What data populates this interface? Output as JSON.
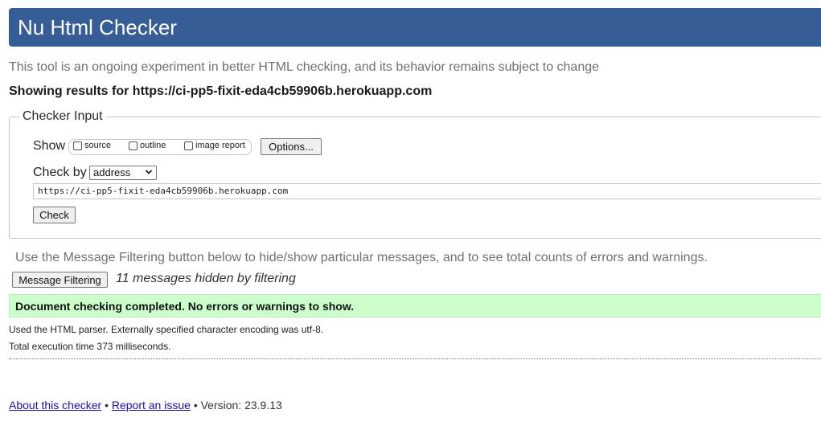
{
  "header": {
    "title": "Nu Html Checker"
  },
  "tagline": "This tool is an ongoing experiment in better HTML checking, and its behavior remains subject to change",
  "showing_results": "Showing results for https://ci-pp5-fixit-eda4cb59906b.herokuapp.com",
  "checker_input": {
    "legend": "Checker Input",
    "show_label": "Show",
    "show_options": [
      {
        "label": "source",
        "checked": false
      },
      {
        "label": "outline",
        "checked": false
      },
      {
        "label": "image report",
        "checked": false
      }
    ],
    "options_button": "Options...",
    "check_by_label": "Check by",
    "check_by_value": "address",
    "url_value": "https://ci-pp5-fixit-eda4cb59906b.herokuapp.com",
    "check_button": "Check"
  },
  "filtering": {
    "help_text": "Use the Message Filtering button below to hide/show particular messages, and to see total counts of errors and warnings.",
    "button_label": "Message Filtering",
    "hidden_count_text": "11 messages hidden by filtering"
  },
  "result": {
    "message": "Document checking completed. No errors or warnings to show.",
    "color": "#ccffcc"
  },
  "details": {
    "parser": "Used the HTML parser. Externally specified character encoding was utf-8.",
    "execution_time": "Total execution time 373 milliseconds."
  },
  "footer": {
    "about_link": "About this checker",
    "separator": "•",
    "report_link": "Report an issue",
    "version_text": "Version: 23.9.13"
  },
  "colors": {
    "header_bg": "#365d95",
    "link": "#1a0dab"
  }
}
